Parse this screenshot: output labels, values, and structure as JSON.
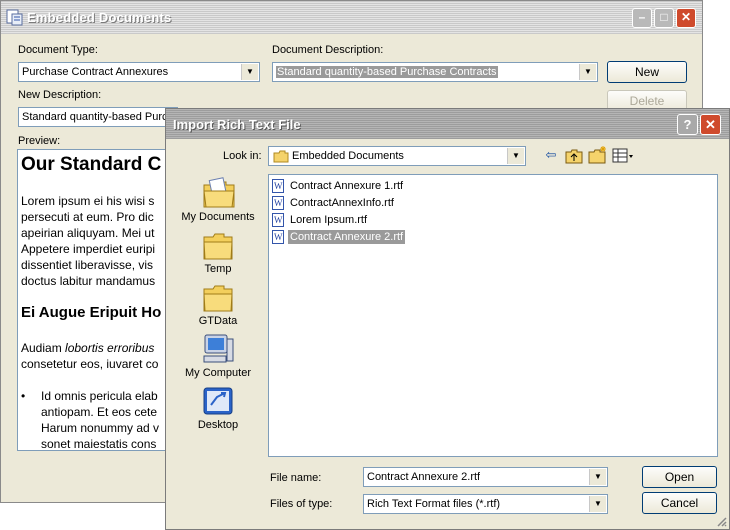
{
  "background_window": {
    "title": "Embedded Documents",
    "document_type_label": "Document Type:",
    "document_type_value": "Purchase Contract Annexures",
    "document_description_label": "Document Description:",
    "document_description_value": "Standard quantity-based Purchase Contracts",
    "new_button": "New",
    "new_description_label": "New Description:",
    "new_description_value": "Standard quantity-based Purch",
    "delete_button": "Delete",
    "preview_label": "Preview:",
    "preview": {
      "heading1": "Our Standard C",
      "para1": [
        "Lorem ipsum ei his wisi s",
        "persecuti at eum. Pro dic",
        "apeirian aliquyam. Mei ut",
        "Appetere imperdiet euripi",
        "dissentiet liberavisse, vis",
        "doctus labitur mandamus"
      ],
      "heading2": "Ei Augue Eripuit Ho",
      "para2_prefix": "Audiam ",
      "para2_italic": "lobortis erroribus",
      "para2_line2": "consetetur eos, iuvaret co",
      "bullet": "•",
      "bullet_lines": [
        "Id omnis pericula elab",
        "antiopam. Et eos cete",
        "Harum nonummy ad v",
        "sonet maiestatis cons"
      ]
    }
  },
  "dialog": {
    "title": "Import Rich Text File",
    "help_button": "?",
    "close_button": "✕",
    "look_in_label": "Look in:",
    "look_in_value": "Embedded Documents",
    "places": [
      {
        "label": "My Documents",
        "icon": "my-documents-icon"
      },
      {
        "label": "Temp",
        "icon": "folder-icon"
      },
      {
        "label": "GTData",
        "icon": "folder-icon"
      },
      {
        "label": "My Computer",
        "icon": "my-computer-icon"
      },
      {
        "label": "Desktop",
        "icon": "desktop-icon"
      }
    ],
    "files": [
      {
        "name": "Contract Annexure 1.rtf",
        "selected": false
      },
      {
        "name": "ContractAnnexInfo.rtf",
        "selected": false
      },
      {
        "name": "Lorem Ipsum.rtf",
        "selected": false
      },
      {
        "name": "Contract Annexure 2.rtf",
        "selected": true
      }
    ],
    "file_name_label": "File name:",
    "file_name_value": "Contract Annexure 2.rtf",
    "files_of_type_label": "Files of type:",
    "files_of_type_value": "Rich Text Format files (*.rtf)",
    "open_button": "Open",
    "cancel_button": "Cancel"
  }
}
